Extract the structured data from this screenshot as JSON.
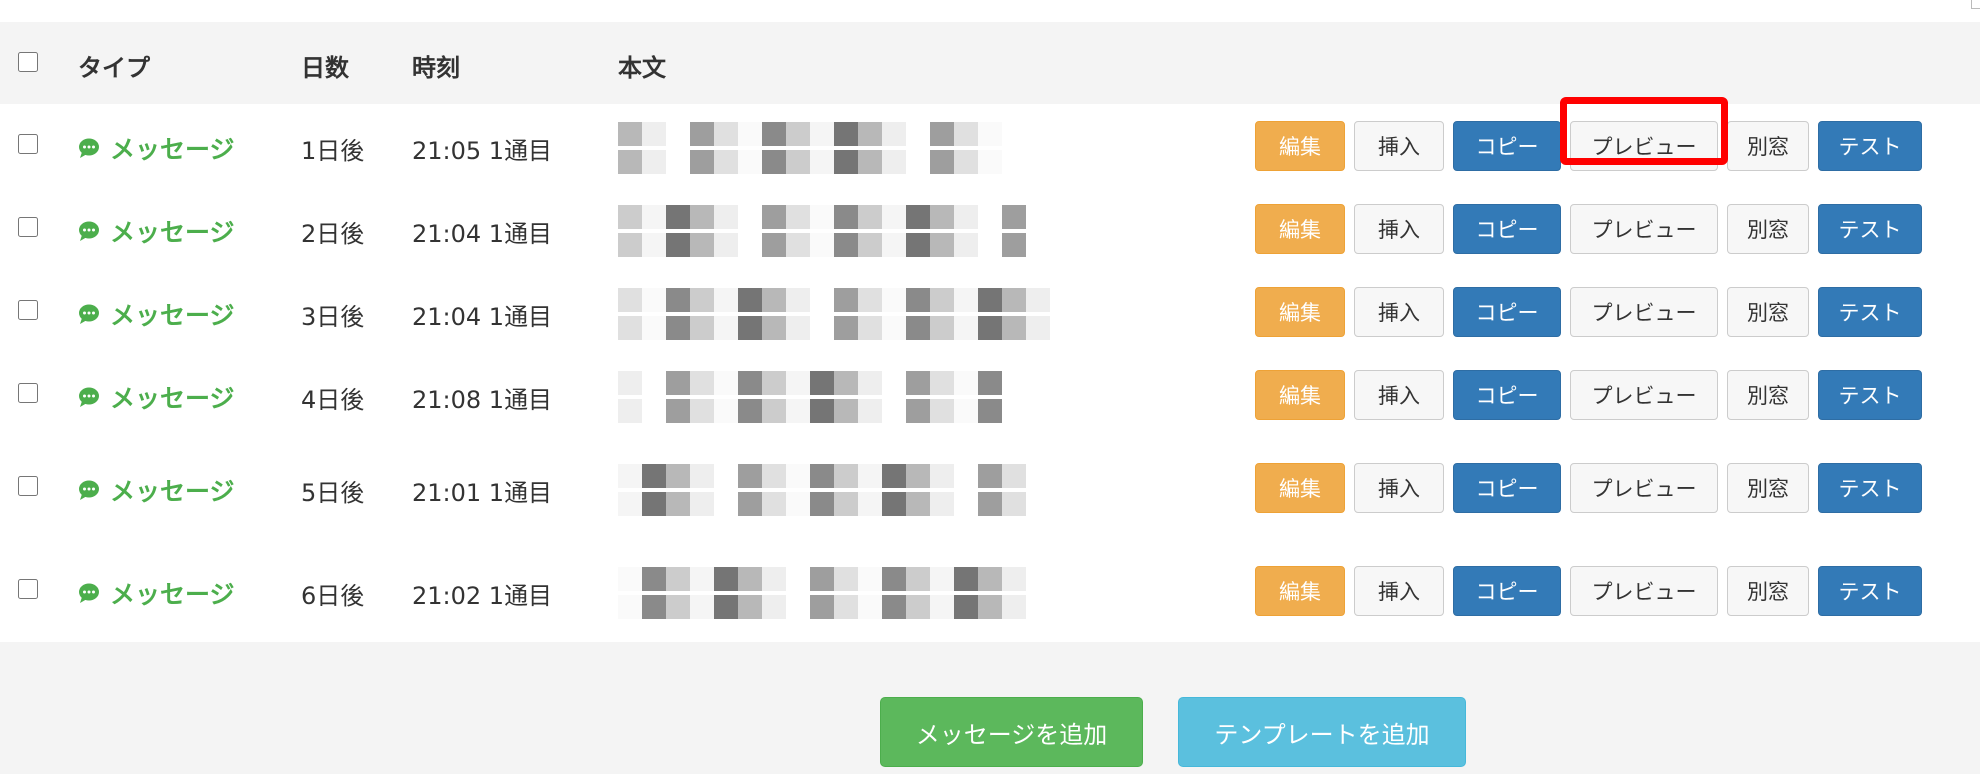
{
  "table": {
    "headers": {
      "type": "タイプ",
      "days": "日数",
      "time": "時刻",
      "body": "本文"
    },
    "rows": [
      {
        "type": "メッセージ",
        "days": "1日後",
        "time": "21:05 1通目"
      },
      {
        "type": "メッセージ",
        "days": "2日後",
        "time": "21:04 1通目"
      },
      {
        "type": "メッセージ",
        "days": "3日後",
        "time": "21:04 1通目"
      },
      {
        "type": "メッセージ",
        "days": "4日後",
        "time": "21:08 1通目"
      },
      {
        "type": "メッセージ",
        "days": "5日後",
        "time": "21:01 1通目"
      },
      {
        "type": "メッセージ",
        "days": "6日後",
        "time": "21:02 1通目"
      }
    ]
  },
  "actions": {
    "edit": "編集",
    "insert": "挿入",
    "copy": "コピー",
    "preview": "プレビュー",
    "new_window": "別窓",
    "test": "テスト"
  },
  "footer": {
    "add_message": "メッセージを追加",
    "add_template": "テンプレートを追加"
  },
  "colors": {
    "type_green": "#4cae4c",
    "edit_orange": "#f0ad4e",
    "primary_blue": "#337ab7",
    "success_green": "#5cb85c",
    "info_cyan": "#5bc0de",
    "highlight_red": "#ff0000"
  },
  "icons": {
    "type_icon": "chat-bubble-icon"
  }
}
